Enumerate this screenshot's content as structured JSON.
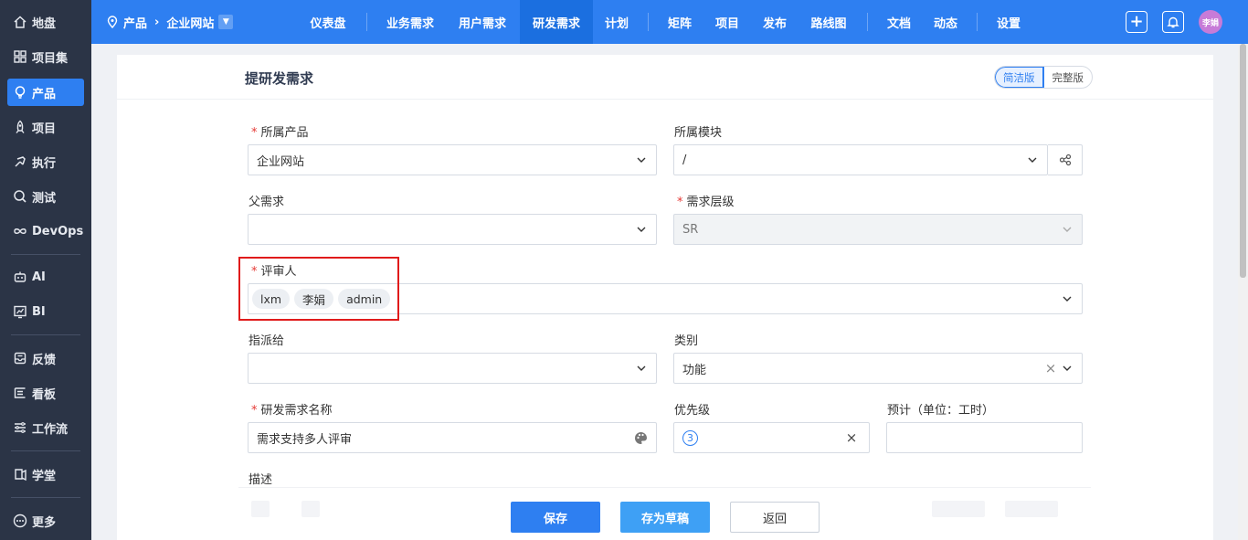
{
  "sidebar": {
    "items": [
      {
        "label": "地盘",
        "icon": "home-icon"
      },
      {
        "label": "项目集",
        "icon": "grid-icon"
      },
      {
        "label": "产品",
        "icon": "lightbulb-icon",
        "active": true
      },
      {
        "label": "项目",
        "icon": "rocket-icon"
      },
      {
        "label": "执行",
        "icon": "run-icon"
      },
      {
        "label": "测试",
        "icon": "search-icon"
      },
      {
        "label": "DevOps",
        "icon": "infinity-icon"
      },
      {
        "label": "AI",
        "icon": "robot-icon"
      },
      {
        "label": "BI",
        "icon": "chart-icon"
      },
      {
        "label": "反馈",
        "icon": "inbox-icon"
      },
      {
        "label": "看板",
        "icon": "kanban-icon"
      },
      {
        "label": "工作流",
        "icon": "workflow-icon"
      },
      {
        "label": "学堂",
        "icon": "school-icon"
      },
      {
        "label": "更多",
        "icon": "more-icon"
      }
    ]
  },
  "header": {
    "breadcrumb": {
      "root": "产品",
      "current": "企业网站"
    },
    "tabs": [
      "仪表盘",
      "业务需求",
      "用户需求",
      "研发需求",
      "计划",
      "矩阵",
      "项目",
      "发布",
      "路线图",
      "文档",
      "动态",
      "设置"
    ],
    "active_tab": "研发需求",
    "avatar_text": "李娟"
  },
  "form": {
    "title": "提研发需求",
    "mode_simple": "简洁版",
    "mode_full": "完整版",
    "product_label": "所属产品",
    "product_value": "企业网站",
    "module_label": "所属模块",
    "module_value": "/",
    "parent_label": "父需求",
    "parent_value": "",
    "level_label": "需求层级",
    "level_value": "SR",
    "reviewer_label": "评审人",
    "reviewers": [
      "lxm",
      "李娟",
      "admin"
    ],
    "assign_label": "指派给",
    "assign_value": "",
    "category_label": "类别",
    "category_value": "功能",
    "name_label": "研发需求名称",
    "name_value": "需求支持多人评审",
    "priority_label": "优先级",
    "priority_value": "3",
    "estimate_label": "预计（单位：工时）",
    "estimate_value": "",
    "desc_label": "描述"
  },
  "footer": {
    "save": "保存",
    "draft": "存为草稿",
    "back": "返回"
  },
  "colors": {
    "primary": "#2e7ff1",
    "sidebar_bg": "#2b3446",
    "required": "#e53935",
    "highlight": "#e01b1b"
  }
}
